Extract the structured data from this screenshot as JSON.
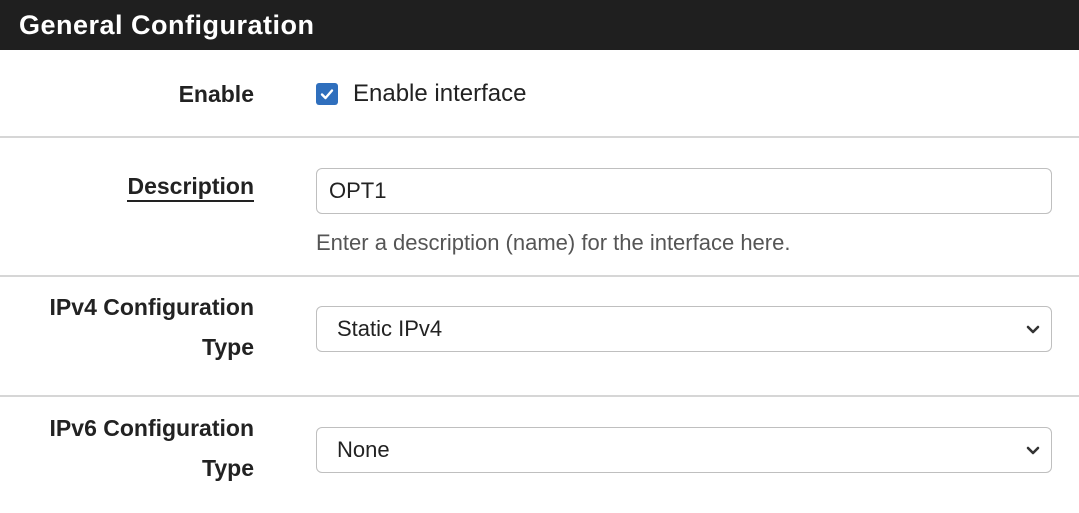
{
  "panel": {
    "title": "General Configuration"
  },
  "enable": {
    "label": "Enable",
    "checkbox_label": "Enable interface",
    "checked": true
  },
  "description": {
    "label": "Description",
    "value": "OPT1",
    "help": "Enter a description (name) for the interface here."
  },
  "ipv4": {
    "label_line1": "IPv4 Configuration",
    "label_line2": "Type",
    "selected": "Static IPv4"
  },
  "ipv6": {
    "label_line1": "IPv6 Configuration",
    "label_line2": "Type",
    "selected": "None"
  },
  "colors": {
    "heading_bg": "#1f1f1f",
    "checkbox_accent": "#2f6fbd"
  }
}
